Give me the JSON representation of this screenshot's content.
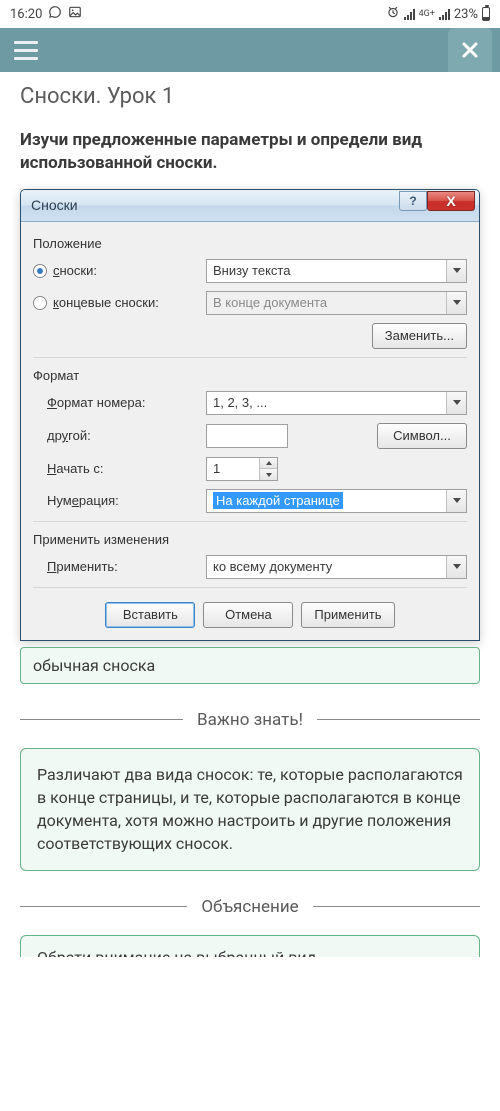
{
  "status": {
    "time": "16:20",
    "network_label": "4G+",
    "battery_pct": "23%"
  },
  "page": {
    "title": "Сноски. Урок 1",
    "instruction": "Изучи предложенные параметры и определи вид использованной сноски."
  },
  "dialog": {
    "title": "Сноски",
    "help": "?",
    "close": "X",
    "groups": {
      "position": {
        "label": "Положение",
        "footnotes_radio": "сноски:",
        "footnotes_value": "Внизу текста",
        "footnotes_checked": true,
        "endnotes_radio": "концевые сноски:",
        "endnotes_value": "В конце документа",
        "endnotes_checked": false,
        "swap_btn": "Заменить..."
      },
      "format": {
        "label": "Формат",
        "number_format_label": "Формат номера:",
        "number_format_value": "1, 2, 3, ...",
        "other_label": "другой:",
        "other_value": "",
        "symbol_btn": "Символ...",
        "start_at_label": "Начать с:",
        "start_at_value": "1",
        "numbering_label": "Нумерация:",
        "numbering_value": "На каждой странице"
      },
      "apply_changes": {
        "label": "Применить изменения",
        "apply_to_label": "Применить:",
        "apply_to_value": "ко всему документу"
      }
    },
    "buttons": {
      "insert": "Вставить",
      "cancel": "Отмена",
      "apply": "Применить"
    }
  },
  "answer": "обычная сноска",
  "sections": {
    "important": {
      "heading": "Важно знать!",
      "text": "Различают два вида сносок: те, которые располагаются в конце страницы, и те, которые располагаются в конце документа, хотя можно настроить и другие положения соответствующих сносок."
    },
    "explanation": {
      "heading": "Объяснение",
      "cutoff_text": "Обрати внимание на выбранный вид"
    }
  }
}
